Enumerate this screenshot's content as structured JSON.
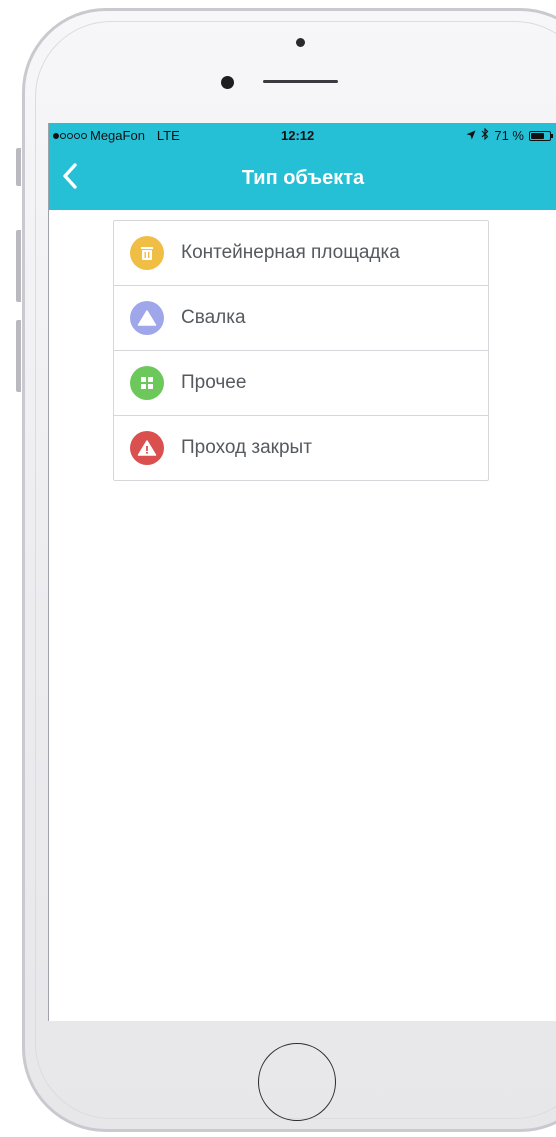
{
  "status_bar": {
    "carrier": "MegaFon",
    "network": "LTE",
    "time": "12:12",
    "battery_text": "71 %",
    "battery_level": 0.71,
    "signal_bars_filled": 1,
    "signal_bars_total": 5
  },
  "header": {
    "title": "Тип объекта",
    "back_icon": "chevron-left-icon"
  },
  "object_types": [
    {
      "label": "Контейнерная площадка",
      "icon": "container-icon",
      "color": "#f0be45"
    },
    {
      "label": "Свалка",
      "icon": "triangle-icon",
      "color": "#9fa6ea"
    },
    {
      "label": "Прочее",
      "icon": "grid-icon",
      "color": "#6cc85a"
    },
    {
      "label": "Проход закрыт",
      "icon": "warning-icon",
      "color": "#d9504f"
    }
  ],
  "theme": {
    "accent": "#25bfd6",
    "text": "#555a5f",
    "divider": "#d5d7da"
  }
}
